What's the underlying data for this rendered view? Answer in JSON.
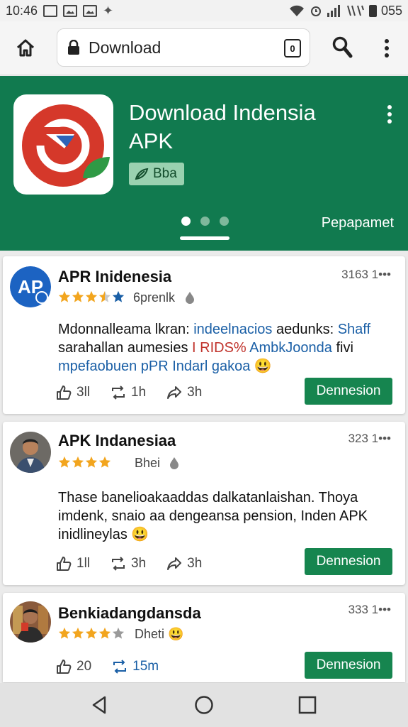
{
  "status_bar": {
    "time": "10:46",
    "battery": "055"
  },
  "toolbar": {
    "url_text": "Download",
    "tab_count": "0"
  },
  "hero": {
    "title": "Download Indensia APK",
    "badge": "Bba",
    "link": "Pepapamet",
    "page_indicator": {
      "count": 3,
      "active": 1
    }
  },
  "cards": [
    {
      "title": "APR Inidenesia",
      "meta": "3163 1•••",
      "rating": 4.5,
      "sub": "6prenlk",
      "body": {
        "p1": "Mdonnalleama lkran: ",
        "p2": "indeelnacios",
        "p3": " aedunks: ",
        "p4": "Shaff",
        "p5": " sarahallan aumesies ",
        "p6": "I",
        "p7": " ",
        "p8": "RIDS%",
        "p9": " ",
        "p10": "AmbkJoonda",
        "p11": " fivi ",
        "p12": "mpefaobuen pPR",
        "p13": " ",
        "p14": "Indarl gakoa",
        "p15": " 😃"
      },
      "likes": "3ll",
      "reposts": "1h",
      "shares": "3h",
      "button": "Dennesion"
    },
    {
      "title": "APK Indanesiaa",
      "meta": "323 1•••",
      "rating": 4,
      "sub": "Bhei",
      "body": "Thase banelioakaaddas dalkatanlaishan. Thoya imdenk, snaio aa dengeansa pension, Inden APK inidlineylas 😃",
      "likes": "1ll",
      "reposts": "3h",
      "shares": "3h",
      "button": "Dennesion"
    },
    {
      "title": "Benkiadangdansda",
      "meta": "333 1•••",
      "rating": 4,
      "sub": "Dheti 😃",
      "likes": "20",
      "reposts": "15m",
      "button": "Dennesion"
    }
  ],
  "colors": {
    "brand_green": "#117a4f",
    "button_green": "#16854f",
    "star": "#f2a51e",
    "star_blue": "#1a5fa6",
    "link_blue": "#1a5fa6",
    "accent_red": "#c0322b"
  }
}
